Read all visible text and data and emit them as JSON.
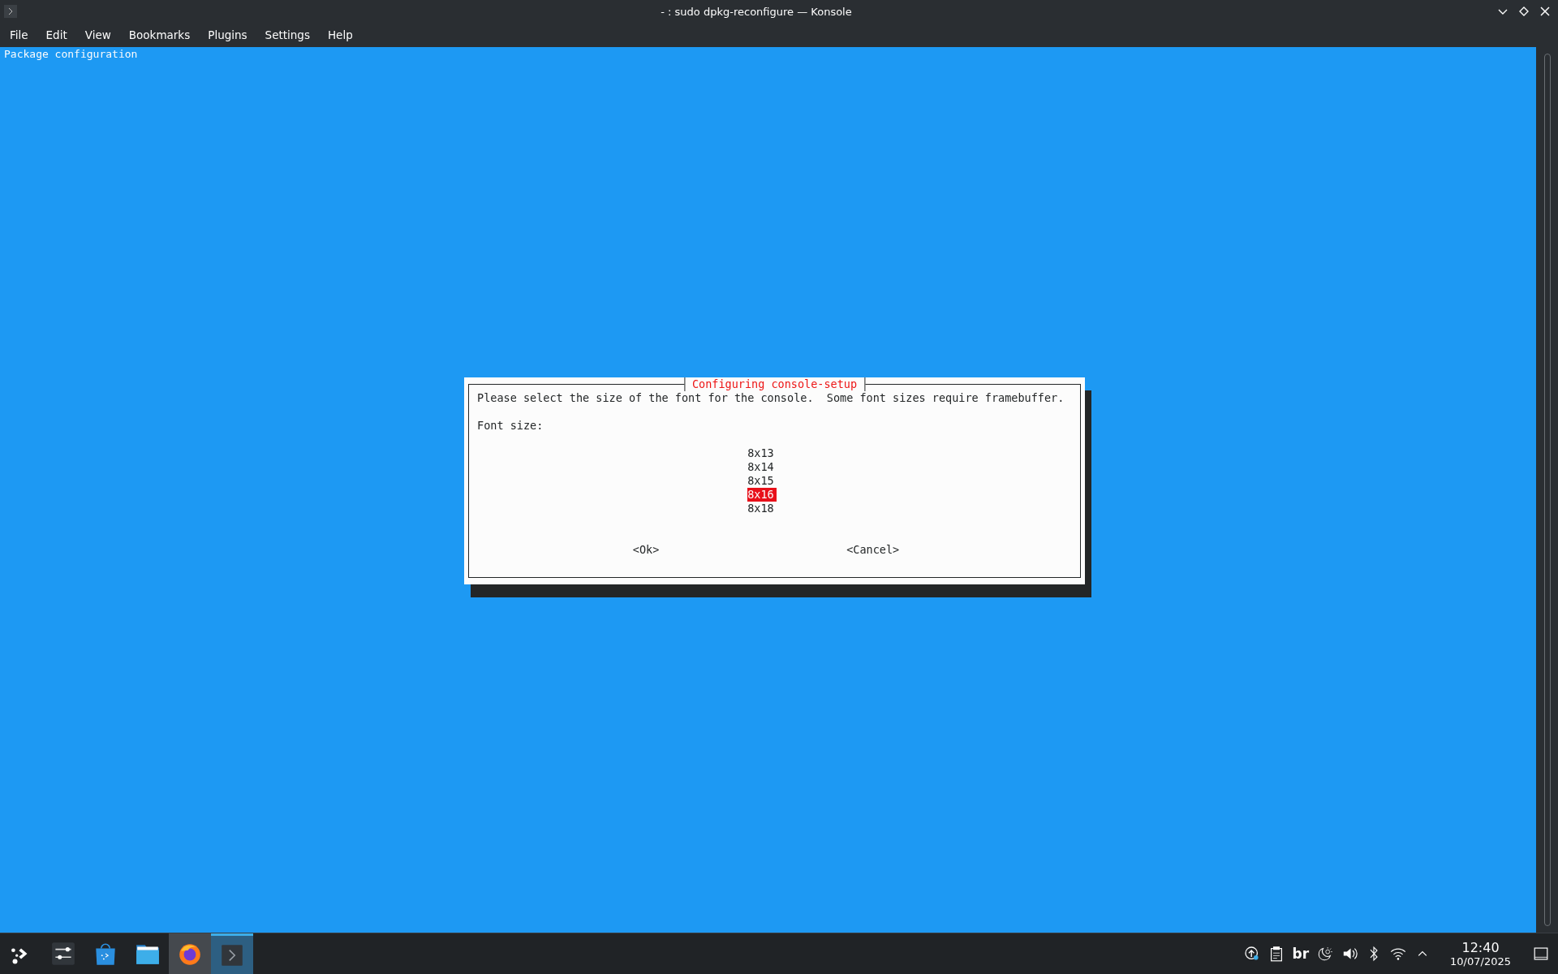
{
  "window": {
    "title": "- : sudo dpkg-reconfigure — Konsole"
  },
  "menu": [
    "File",
    "Edit",
    "View",
    "Bookmarks",
    "Plugins",
    "Settings",
    "Help"
  ],
  "terminal": {
    "header": "Package configuration",
    "dialog": {
      "title": "Configuring console-setup",
      "prompt": "Please select the size of the font for the console.  Some font sizes require framebuffer.",
      "label": "Font size:",
      "options": [
        {
          "label": "8x13",
          "selected": false
        },
        {
          "label": "8x14",
          "selected": false
        },
        {
          "label": "8x15",
          "selected": false
        },
        {
          "label": "8x16",
          "selected": true
        },
        {
          "label": "8x18",
          "selected": false
        }
      ],
      "buttons": [
        "<Ok>",
        "<Cancel>"
      ]
    }
  },
  "taskbar": {
    "apps": [
      {
        "kind": "launcher",
        "active": false,
        "hovered": false
      },
      {
        "kind": "settings",
        "active": false,
        "hovered": false
      },
      {
        "kind": "store",
        "active": false,
        "hovered": false
      },
      {
        "kind": "files",
        "active": false,
        "hovered": false
      },
      {
        "kind": "browser",
        "active": false,
        "hovered": true
      },
      {
        "kind": "terminal",
        "active": true,
        "hovered": false
      }
    ],
    "tray": [
      {
        "kind": "updates"
      },
      {
        "kind": "clipboard"
      },
      {
        "kind": "keyboard",
        "text": "br"
      },
      {
        "kind": "night"
      },
      {
        "kind": "volume"
      },
      {
        "kind": "bluetooth"
      },
      {
        "kind": "wifi"
      },
      {
        "kind": "expand"
      }
    ],
    "clock": {
      "time": "12:40",
      "date": "10/07/2025"
    }
  }
}
